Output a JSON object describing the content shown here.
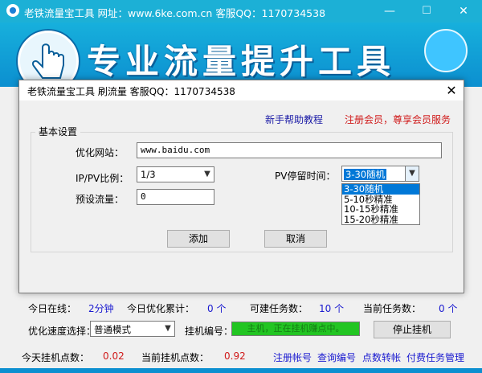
{
  "main_window": {
    "title": "老铁流量宝工具 网址：www.6ke.com.cn 客服QQ：1170734538",
    "banner_title": "专业流量提升工具",
    "controls": {
      "minimize": "—",
      "maximize": "☐",
      "close": "✕"
    }
  },
  "dialog": {
    "title": "老铁流量宝工具 刷流量 客服QQ：1170734538",
    "close": "✕",
    "help_link": "新手帮助教程",
    "register_link": "注册会员，尊享会员服务",
    "group_label": "基本设置",
    "site_label": "优化网站：",
    "site_value": "www.baidu.com",
    "ratio_label": "IP/PV比例：",
    "ratio_value": "1/3",
    "pv_stay_label": "PV停留时间：",
    "pv_stay_value": "3-30随机",
    "pv_stay_options": [
      "3-30随机",
      "5-10秒精准",
      "10-15秒精准",
      "15-20秒精准"
    ],
    "preset_label": "预设流量：",
    "preset_value": "0",
    "add_button": "添加",
    "cancel_button": "取消"
  },
  "stats": {
    "online_today_label": "今日在线：",
    "online_today_value": "2分钟",
    "optimized_today_label": "今日优化累计：",
    "optimized_today_value": "0 个",
    "available_tasks_label": "可建任务数：",
    "available_tasks_value": "10 个",
    "current_tasks_label": "当前任务数：",
    "current_tasks_value": "0 个",
    "speed_label": "优化速度选择：",
    "speed_value": "普通模式",
    "machine_label": "挂机编号：",
    "machine_status": "主机，正在挂机赚点中。",
    "stop_button": "停止挂机",
    "points_today_label": "今天挂机点数：",
    "points_today_value": "0.02",
    "points_current_label": "当前挂机点数：",
    "points_current_value": "0.92",
    "links": [
      "注册帐号",
      "查询编号",
      "点数转帐",
      "付费任务管理"
    ]
  },
  "colors": {
    "titlebar": "#1cb0d6",
    "banner": "#0c8fd0",
    "status_green": "#22c522"
  }
}
